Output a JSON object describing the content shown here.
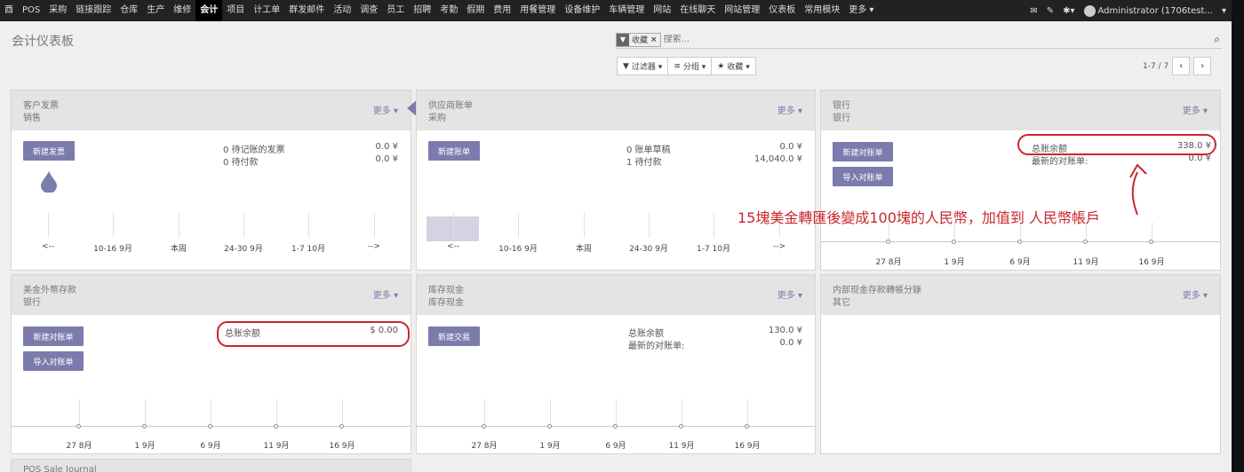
{
  "nav": {
    "items": [
      "酉",
      "POS",
      "采购",
      "链接跟踪",
      "仓库",
      "生产",
      "维修",
      "会计",
      "项目",
      "计工单",
      "群发邮件",
      "活动",
      "调查",
      "员工",
      "招聘",
      "考勤",
      "假期",
      "费用",
      "用餐管理",
      "设备维护",
      "车辆管理",
      "网站",
      "在线聊天",
      "网站管理",
      "仪表板",
      "常用模块",
      "更多 ▾"
    ],
    "active": "会计",
    "user": "Administrator (1706test...",
    "user_caret": "▾"
  },
  "breadcrumb": "会计仪表板",
  "search": {
    "facet_label": "收藏",
    "facet_remove": "×",
    "placeholder": "搜索..."
  },
  "buttons": {
    "filter": "过滤器 ▾",
    "group": "分组 ▾",
    "favorite": "收藏 ▾"
  },
  "pager": {
    "value": "1-7 / 7",
    "prev": "‹",
    "next": "›"
  },
  "cards": {
    "customer_invoices": {
      "title": "客户发票",
      "subtitle": "销售",
      "more": "更多 ▾",
      "button": "新建发票",
      "rows": [
        {
          "label": "0 待记账的发票",
          "value": "0.0 ¥"
        },
        {
          "label": "0 待付款",
          "value": "0.0 ¥"
        }
      ],
      "xlabels": [
        "<--",
        "10-16 9月",
        "本周",
        "24-30 9月",
        "1-7 10月",
        "-->"
      ]
    },
    "vendor_bills": {
      "title": "供应商账单",
      "subtitle": "采购",
      "more": "更多 ▾",
      "button": "新建账单",
      "rows": [
        {
          "label": "0 账单草稿",
          "value": "0.0 ¥"
        },
        {
          "label": "1 待付款",
          "value": "14,040.0 ¥"
        }
      ],
      "xlabels": [
        "<--",
        "10-16 9月",
        "本周",
        "24-30 9月",
        "1-7 10月",
        "-->"
      ]
    },
    "bank": {
      "title": "银行",
      "subtitle": "银行",
      "more": "更多 ▾",
      "button1": "新建对账单",
      "button2": "导入对账单",
      "rows": [
        {
          "label": "总账余额",
          "value": "338.0 ¥"
        },
        {
          "label": "最新的对账单:",
          "value": "0.0 ¥"
        }
      ],
      "xlabels": [
        "27 8月",
        "1 9月",
        "6 9月",
        "11 9月",
        "16 9月"
      ]
    },
    "usd_deposit": {
      "title": "美金外幣存款",
      "subtitle": "银行",
      "more": "更多 ▾",
      "button1": "新建对账单",
      "button2": "导入对账单",
      "rows": [
        {
          "label": "总账余额",
          "value": "$ 0.00"
        }
      ],
      "xlabels": [
        "27 8月",
        "1 9月",
        "6 9月",
        "11 9月",
        "16 9月"
      ]
    },
    "cash": {
      "title": "库存现金",
      "subtitle": "库存现金",
      "more": "更多 ▾",
      "button": "新建交易",
      "rows": [
        {
          "label": "总账余额",
          "value": "130.0 ¥"
        },
        {
          "label": "最新的对账单:",
          "value": "0.0 ¥"
        }
      ],
      "xlabels": [
        "27 8月",
        "1 9月",
        "6 9月",
        "11 9月",
        "16 9月"
      ]
    },
    "internal_transfer": {
      "title": "内部现金存款轉帳分錄",
      "subtitle": "其它",
      "more": "更多 ▾"
    },
    "pos_journal": {
      "title": "POS Sale Journal"
    }
  },
  "annotation": {
    "text": "15塊美金轉匯後變成100塊的人民幣，加值到 人民幣帳戶",
    "color": "#c9262e"
  },
  "colors": {
    "primary": "#7c7bad",
    "navbar": "#222222",
    "header_bg": "#e4e4e4"
  }
}
